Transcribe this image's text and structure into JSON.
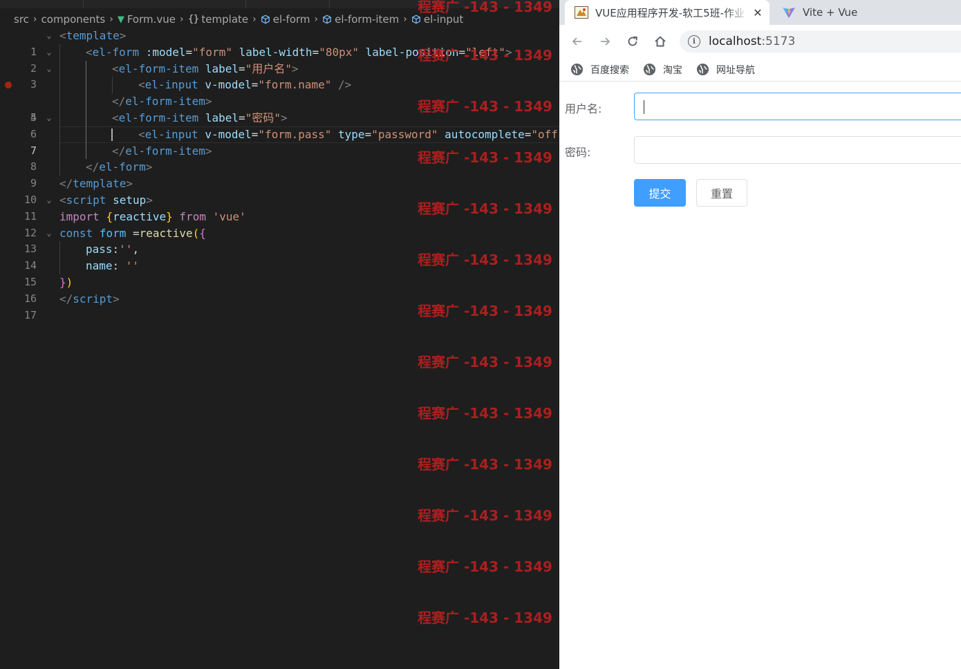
{
  "editor": {
    "breadcrumb": {
      "segments": [
        "src",
        "components",
        "Form.vue",
        "template",
        "el-form",
        "el-form-item",
        "el-input"
      ]
    },
    "line_numbers": [
      "1",
      "2",
      "3",
      "4",
      "5",
      "6",
      "7",
      "8",
      "9",
      "10",
      "11",
      "12",
      "13",
      "14",
      "15",
      "16",
      "17"
    ],
    "code": {
      "l1": {
        "open": "<",
        "tag": "template",
        "close": ">"
      },
      "l2": {
        "open": "<",
        "tag": "el-form",
        "sp1": " ",
        "attr1": ":model",
        "eq1": "=",
        "val1": "\"form\"",
        "sp2": " ",
        "attr2": "label-width",
        "eq2": "=",
        "val2": "\"80px\"",
        "sp3": " ",
        "attr3": "label-position",
        "eq3": "=",
        "val3": "\"left\"",
        "close": ">"
      },
      "l3": {
        "open": "<",
        "tag": "el-form-item",
        "sp1": " ",
        "attr1": "label",
        "eq1": "=",
        "val1": "\"用户名\"",
        "close": ">"
      },
      "l4": {
        "open": "<",
        "tag": "el-input",
        "sp1": " ",
        "attr1": "v-model",
        "eq1": "=",
        "val1": "\"form.name\"",
        "close": " />"
      },
      "l5": {
        "open": "</",
        "tag": "el-form-item",
        "close": ">"
      },
      "l6": {
        "open": "<",
        "tag": "el-form-item",
        "sp1": " ",
        "attr1": "label",
        "eq1": "=",
        "val1": "\"密码\"",
        "close": ">"
      },
      "l7": {
        "open": "<",
        "tag": "el-input",
        "sp1": " ",
        "attr1": "v-model",
        "eq1": "=",
        "val1": "\"form.pass\"",
        "sp2": " ",
        "attr2": "type",
        "eq2": "=",
        "val2": "\"password\"",
        "sp3": " ",
        "attr3": "autocomplete",
        "eq3": "=",
        "val3": "\"off"
      },
      "l8": {
        "open": "</",
        "tag": "el-form-item",
        "close": ">"
      },
      "l9": {
        "open": "</",
        "tag": "el-form",
        "close": ">"
      },
      "l10": {
        "open": "</",
        "tag": "template",
        "close": ">"
      },
      "l11": {
        "open": "<",
        "tag": "script",
        "sp1": " ",
        "attr1": "setup",
        "close": ">"
      },
      "l12": {
        "kw": "import",
        "sp1": " ",
        "b_open": "{",
        "name": "reactive",
        "b_close": "}",
        "sp2": " ",
        "kw2": "from",
        "sp3": " ",
        "str": "'vue'"
      },
      "l13": {
        "decl": "const",
        "sp1": " ",
        "var": "form",
        "op": " =",
        "fn": "reactive",
        "p_open": "(",
        "b_open": "{"
      },
      "l14": {
        "prop": "pass",
        "colon": ":",
        "str": "''",
        "comma": ","
      },
      "l15": {
        "prop": "name",
        "colon": ": ",
        "str": "''"
      },
      "l16": {
        "b_close": "}",
        "p_close": ")"
      },
      "l17": {
        "open": "</",
        "tag": "script",
        "close": ">"
      }
    }
  },
  "watermark": {
    "text": "程赛广 -143 - 1349"
  },
  "browser": {
    "tabs": [
      {
        "title": "VUE应用程序开发-软工5班-作业",
        "close": "✕"
      },
      {
        "title": "Vite + Vue"
      }
    ],
    "url": {
      "host": "localhost",
      "port": ":5173"
    },
    "bookmarks": [
      "百度搜索",
      "淘宝",
      "网址导航"
    ],
    "form": {
      "username_label": "用户名:",
      "username_value": "",
      "password_label": "密码:",
      "password_value": "",
      "submit_label": "提交",
      "reset_label": "重置"
    },
    "colors": {
      "primary": "#409eff",
      "focus_border": "#409eff"
    }
  }
}
